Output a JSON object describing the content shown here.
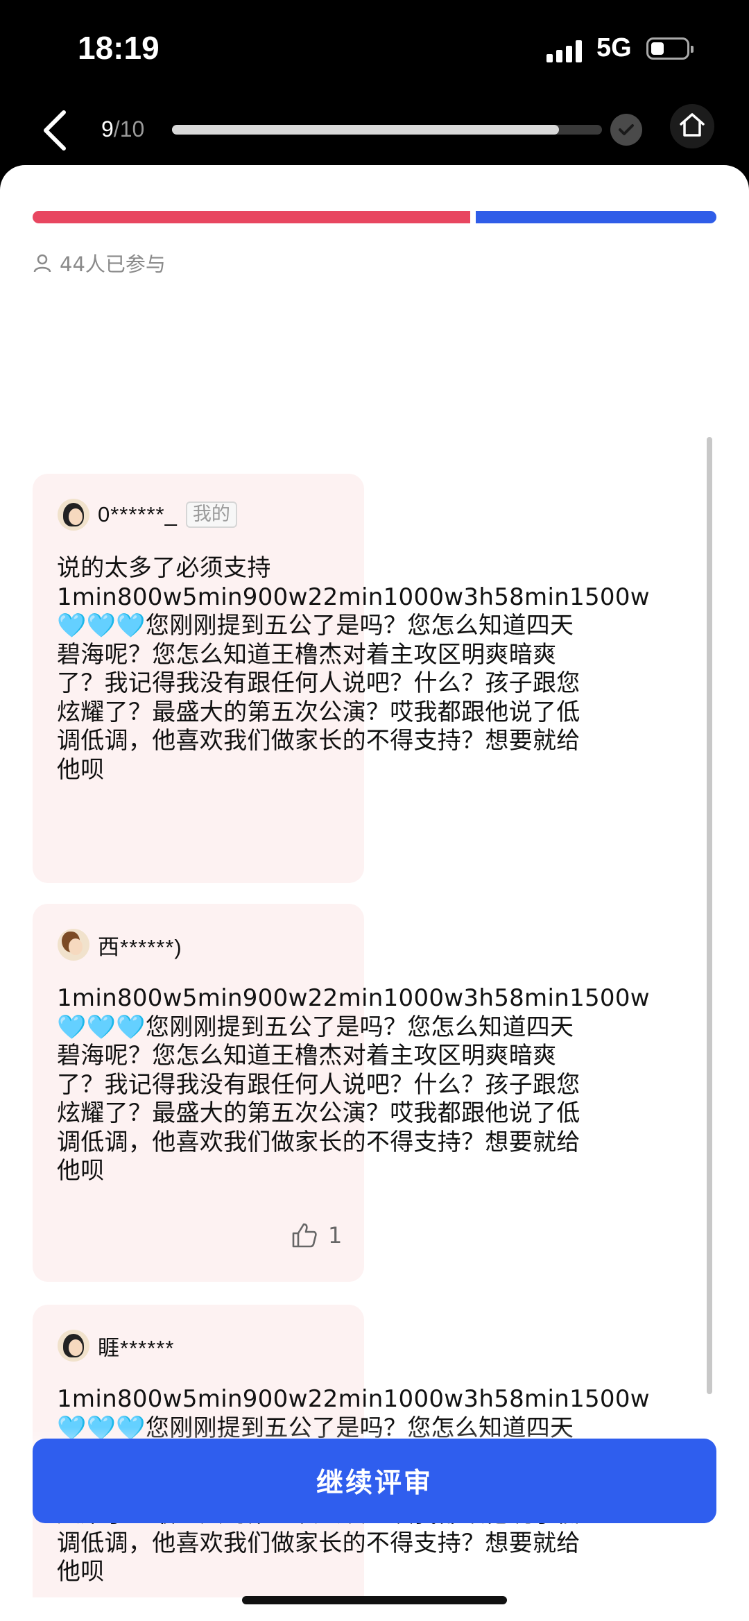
{
  "status_bar": {
    "time": "18:19",
    "network": "5G"
  },
  "nav": {
    "progress_current": "9",
    "progress_total": "/10",
    "progress_fraction": 0.9
  },
  "vote_split": {
    "red_fraction": 0.64,
    "red_color": "#e84660",
    "blue_color": "#2f5de8"
  },
  "participants": {
    "text": "44人已参与",
    "icon": "person-icon"
  },
  "comments": [
    {
      "username": "0******_",
      "badge": "我的",
      "text": "说的太多了必须支持\n1min800w5min900w22min1000w3h58min1500w\n🩵🩵🩵您刚刚提到五公了是吗？您怎么知道四天\n碧海呢？您怎么知道王橹杰对着主攻区明爽暗爽\n了？我记得我没有跟任何人说吧？什么？孩子跟您\n炫耀了？最盛大的第五次公演？哎我都跟他说了低\n调低调，他喜欢我们做家长的不得支持？想要就给\n他呗"
    },
    {
      "username": "西******)",
      "text": "1min800w5min900w22min1000w3h58min1500w\n🩵🩵🩵您刚刚提到五公了是吗？您怎么知道四天\n碧海呢？您怎么知道王橹杰对着主攻区明爽暗爽\n了？我记得我没有跟任何人说吧？什么？孩子跟您\n炫耀了？最盛大的第五次公演？哎我都跟他说了低\n调低调，他喜欢我们做家长的不得支持？想要就给\n他呗",
      "likes": "1"
    },
    {
      "username": "睚******",
      "text": "1min800w5min900w22min1000w3h58min1500w\n🩵🩵🩵您刚刚提到五公了是吗？您怎么知道四天\n碧海呢？您怎么知道王橹杰对着主攻区明爽暗爽\n了？我记得我没有跟任何人说吧？什么？孩子跟您\n炫耀了？最盛大的第五次公演？哎我都跟他说了低\n调低调，他喜欢我们做家长的不得支持？想要就给\n他呗"
    }
  ],
  "cta": {
    "label": "继续评审",
    "color": "#2f5eee"
  }
}
